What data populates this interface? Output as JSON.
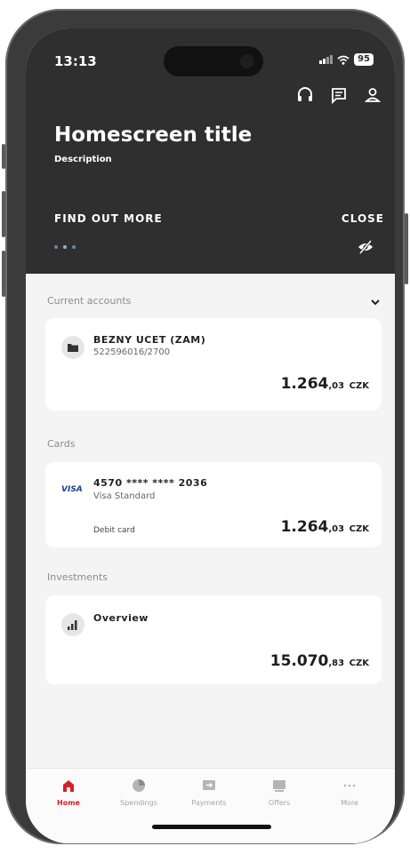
{
  "status_bar": {
    "time": "13:13",
    "battery": "95"
  },
  "header": {
    "title": "Homescreen title",
    "description": "Description",
    "find_out_more": "FIND OUT MORE",
    "close": "CLOSE",
    "icons": [
      "headset-icon",
      "message-icon",
      "profile-icon"
    ]
  },
  "sections": {
    "current_accounts": {
      "label": "Current accounts",
      "account": {
        "name": "BEZNY UCET (ZAM)",
        "number": "522596016/2700",
        "amount_main": "1.264",
        "amount_decimals": ",03",
        "currency": "CZK"
      }
    },
    "cards": {
      "label": "Cards",
      "card": {
        "brand": "VISA",
        "number": "4570 **** **** 2036",
        "product": "Visa Standard",
        "type": "Debit card",
        "amount_main": "1.264",
        "amount_decimals": ",03",
        "currency": "CZK"
      }
    },
    "investments": {
      "label": "Investments",
      "item": {
        "name": "Overview",
        "amount_main": "15.070",
        "amount_decimals": ",83",
        "currency": "CZK"
      }
    }
  },
  "tabbar": {
    "tabs": [
      {
        "label": "Home",
        "icon": "home-icon",
        "active": true
      },
      {
        "label": "Spendings",
        "icon": "pie-chart-icon",
        "active": false
      },
      {
        "label": "Payments",
        "icon": "payment-icon",
        "active": false
      },
      {
        "label": "Offers",
        "icon": "offers-icon",
        "active": false
      },
      {
        "label": "More",
        "icon": "more-icon",
        "active": false
      }
    ]
  },
  "colors": {
    "header_bg": "#2f2f2f",
    "accent": "#d32029",
    "background": "#f4f4f4"
  }
}
